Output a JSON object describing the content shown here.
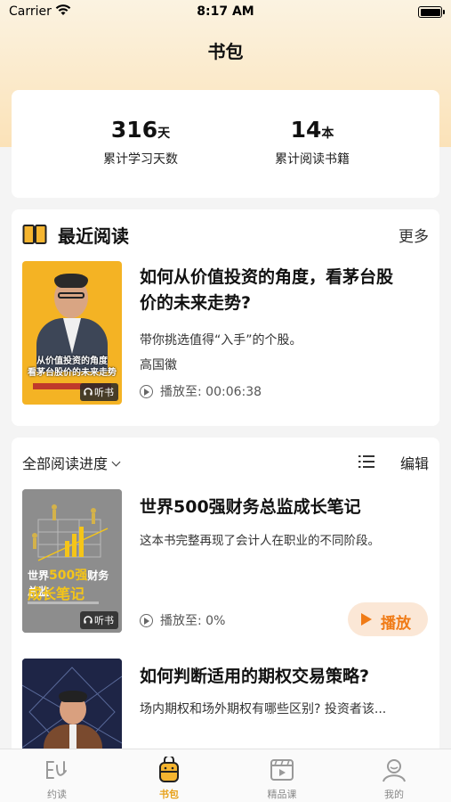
{
  "status_bar": {
    "carrier": "Carrier",
    "time": "8:17 AM"
  },
  "header": {
    "title": "书包"
  },
  "stats": {
    "days_value": "316",
    "days_unit": "天",
    "days_label": "累计学习天数",
    "books_value": "14",
    "books_unit": "本",
    "books_label": "累计阅读书籍"
  },
  "recent": {
    "title": "最近阅读",
    "more_label": "更多",
    "book": {
      "cover_text_line1": "从价值投资的角度",
      "cover_text_line2": "看茅台股价的未来走势",
      "cover_badge": "听书",
      "title_line1": "如何从价值投资的角度，看茅台股",
      "title_line2": "价的未来走势?",
      "description": "带你挑选值得“入手”的个股。",
      "author": "高国徽",
      "play_status": "播放至: 00:06:38"
    }
  },
  "library": {
    "filter_label": "全部阅读进度",
    "edit_label": "编辑",
    "books": [
      {
        "cover_text_a": "世界",
        "cover_text_hl": "500强",
        "cover_text_b": "财务总监",
        "cover_text_c": "成长笔记",
        "cover_badge": "听书",
        "title": "世界500强财务总监成长笔记",
        "description": "这本书完整再现了会计人在职业的不同阶段。",
        "play_status": "播放至: 0%",
        "play_button_label": "播放"
      },
      {
        "title": "如何判断适用的期权交易策略?",
        "description": "场内期权和场外期权有哪些区别? 投资者该..."
      }
    ]
  },
  "tab_bar": {
    "tabs": [
      {
        "label": "约读",
        "icon": "yuedu-icon",
        "active": false
      },
      {
        "label": "书包",
        "icon": "bag-icon",
        "active": true
      },
      {
        "label": "精品课",
        "icon": "video-course-icon",
        "active": false
      },
      {
        "label": "我的",
        "icon": "profile-icon",
        "active": false
      }
    ]
  },
  "colors": {
    "accent": "#f07b16",
    "tab_active": "#e7a11a",
    "header_gradient_top": "#fbf3e1",
    "header_gradient_bottom": "#fbe2b8"
  }
}
